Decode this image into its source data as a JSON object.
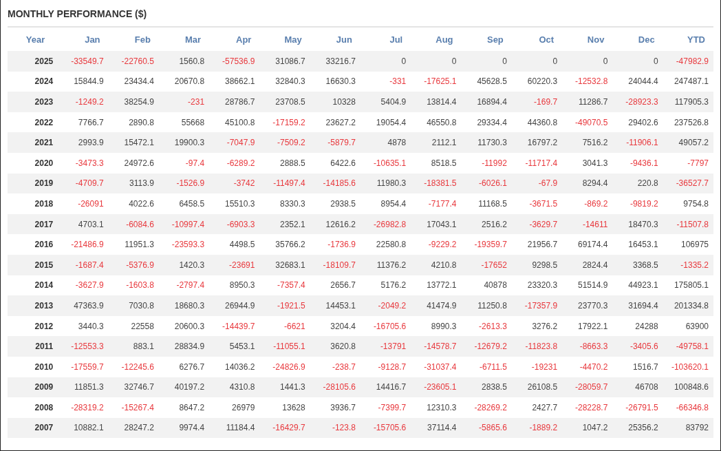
{
  "title": "MONTHLY PERFORMANCE ($)",
  "table": {
    "columns": [
      "Year",
      "Jan",
      "Feb",
      "Mar",
      "Apr",
      "May",
      "Jun",
      "Jul",
      "Aug",
      "Sep",
      "Oct",
      "Nov",
      "Dec",
      "YTD"
    ],
    "rows": [
      [
        "2025",
        "-33549.7",
        "-22760.5",
        "1560.8",
        "-57536.9",
        "31086.7",
        "33216.7",
        "0",
        "0",
        "0",
        "0",
        "0",
        "0",
        "-47982.9"
      ],
      [
        "2024",
        "15844.9",
        "23434.4",
        "20670.8",
        "38662.1",
        "32840.3",
        "16630.3",
        "-331",
        "-17625.1",
        "45628.5",
        "60220.3",
        "-12532.8",
        "24044.4",
        "247487.1"
      ],
      [
        "2023",
        "-1249.2",
        "38254.9",
        "-231",
        "28786.7",
        "23708.5",
        "10328",
        "5404.9",
        "13814.4",
        "16894.4",
        "-169.7",
        "11286.7",
        "-28923.3",
        "117905.3"
      ],
      [
        "2022",
        "7766.7",
        "2890.8",
        "55668",
        "45100.8",
        "-17159.2",
        "23627.2",
        "19054.4",
        "46550.8",
        "29334.4",
        "44360.8",
        "-49070.5",
        "29402.6",
        "237526.8"
      ],
      [
        "2021",
        "2993.9",
        "15472.1",
        "19900.3",
        "-7047.9",
        "-7509.2",
        "-5879.7",
        "4878",
        "2112.1",
        "11730.3",
        "16797.2",
        "7516.2",
        "-11906.1",
        "49057.2"
      ],
      [
        "2020",
        "-3473.3",
        "24972.6",
        "-97.4",
        "-6289.2",
        "2888.5",
        "6422.6",
        "-10635.1",
        "8518.5",
        "-11992",
        "-11717.4",
        "3041.3",
        "-9436.1",
        "-7797"
      ],
      [
        "2019",
        "-4709.7",
        "3113.9",
        "-1526.9",
        "-3742",
        "-11497.4",
        "-14185.6",
        "11980.3",
        "-18381.5",
        "-6026.1",
        "-67.9",
        "8294.4",
        "220.8",
        "-36527.7"
      ],
      [
        "2018",
        "-26091",
        "4022.6",
        "6458.5",
        "15510.3",
        "8330.3",
        "2938.5",
        "8954.4",
        "-7177.4",
        "11168.5",
        "-3671.5",
        "-869.2",
        "-9819.2",
        "9754.8"
      ],
      [
        "2017",
        "4703.1",
        "-6084.6",
        "-10997.4",
        "-6903.3",
        "2352.1",
        "12616.2",
        "-26982.8",
        "17043.1",
        "2516.2",
        "-3629.7",
        "-14611",
        "18470.3",
        "-11507.8"
      ],
      [
        "2016",
        "-21486.9",
        "11951.3",
        "-23593.3",
        "4498.5",
        "35766.2",
        "-1736.9",
        "22580.8",
        "-9229.2",
        "-19359.7",
        "21956.7",
        "69174.4",
        "16453.1",
        "106975"
      ],
      [
        "2015",
        "-1687.4",
        "-5376.9",
        "1420.3",
        "-23691",
        "32683.1",
        "-18109.7",
        "11376.2",
        "4210.8",
        "-17652",
        "9298.5",
        "2824.4",
        "3368.5",
        "-1335.2"
      ],
      [
        "2014",
        "-3627.9",
        "-1603.8",
        "-2797.4",
        "8950.3",
        "-7357.4",
        "2656.7",
        "5176.2",
        "13772.1",
        "40878",
        "23320.3",
        "51514.9",
        "44923.1",
        "175805.1"
      ],
      [
        "2013",
        "47363.9",
        "7030.8",
        "18680.3",
        "26944.9",
        "-1921.5",
        "14453.1",
        "-2049.2",
        "41474.9",
        "11250.8",
        "-17357.9",
        "23770.3",
        "31694.4",
        "201334.8"
      ],
      [
        "2012",
        "3440.3",
        "22558",
        "20600.3",
        "-14439.7",
        "-6621",
        "3204.4",
        "-16705.6",
        "8990.3",
        "-2613.3",
        "3276.2",
        "17922.1",
        "24288",
        "63900"
      ],
      [
        "2011",
        "-12553.3",
        "883.1",
        "28834.9",
        "5453.1",
        "-11055.1",
        "3620.8",
        "-13791",
        "-14578.7",
        "-12679.2",
        "-11823.8",
        "-8663.3",
        "-3405.6",
        "-49758.1"
      ],
      [
        "2010",
        "-17559.7",
        "-12245.6",
        "6276.7",
        "14036.2",
        "-24826.9",
        "-238.7",
        "-9128.7",
        "-31037.4",
        "-6711.5",
        "-19231",
        "-4470.2",
        "1516.7",
        "-103620.1"
      ],
      [
        "2009",
        "11851.3",
        "32746.7",
        "40197.2",
        "4310.8",
        "1441.3",
        "-28105.6",
        "14416.7",
        "-23605.1",
        "2838.5",
        "26108.5",
        "-28059.7",
        "46708",
        "100848.6"
      ],
      [
        "2008",
        "-28319.2",
        "-15267.4",
        "8647.2",
        "26979",
        "13628",
        "3936.7",
        "-7399.7",
        "12310.3",
        "-28269.2",
        "2427.7",
        "-28228.7",
        "-26791.5",
        "-66346.8"
      ],
      [
        "2007",
        "10882.1",
        "28247.2",
        "9974.4",
        "11184.4",
        "-16429.7",
        "-123.8",
        "-15705.6",
        "37114.4",
        "-5865.6",
        "-1889.2",
        "1047.2",
        "25356.2",
        "83792"
      ]
    ]
  }
}
